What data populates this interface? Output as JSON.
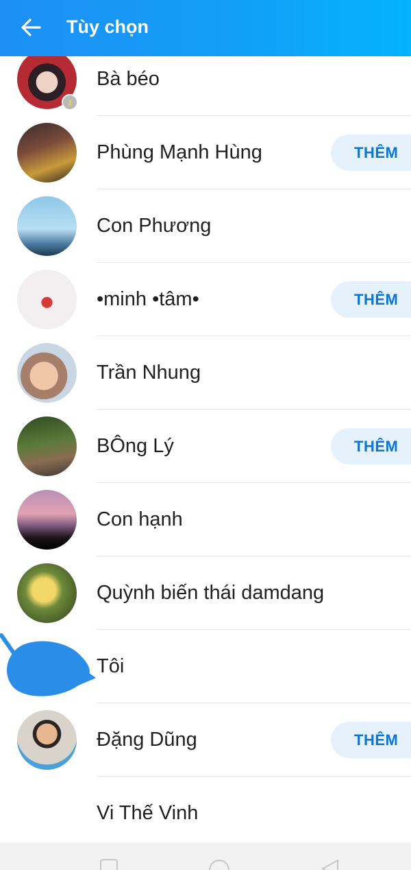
{
  "header": {
    "title": "Tùy chọn",
    "back_icon": "arrow-left-icon"
  },
  "members": [
    {
      "name": "Bà béo",
      "show_add": false,
      "badge_icon": "key-icon"
    },
    {
      "name": "Phùng Mạnh Hùng",
      "show_add": true
    },
    {
      "name": "Con Phương",
      "show_add": false
    },
    {
      "name": "•minh •tâm•",
      "show_add": true
    },
    {
      "name": "Trần Nhung",
      "show_add": false
    },
    {
      "name": "BÔng Lý",
      "show_add": true
    },
    {
      "name": "Con hạnh",
      "show_add": false
    },
    {
      "name": "Quỳnh biến thái damdang",
      "show_add": false
    },
    {
      "name": "Tôi",
      "show_add": false
    },
    {
      "name": "Đặng Dũng",
      "show_add": true
    },
    {
      "name": "Vi Thế Vinh",
      "show_add": false
    }
  ],
  "add_label": "THÊM",
  "navbar": {
    "icons": [
      "recents-icon",
      "home-icon",
      "back-triangle-icon"
    ]
  },
  "colors": {
    "header_start": "#1e8ff5",
    "header_end": "#04b3fb",
    "button_bg": "#e6f2fb",
    "button_text": "#0b74d4"
  }
}
